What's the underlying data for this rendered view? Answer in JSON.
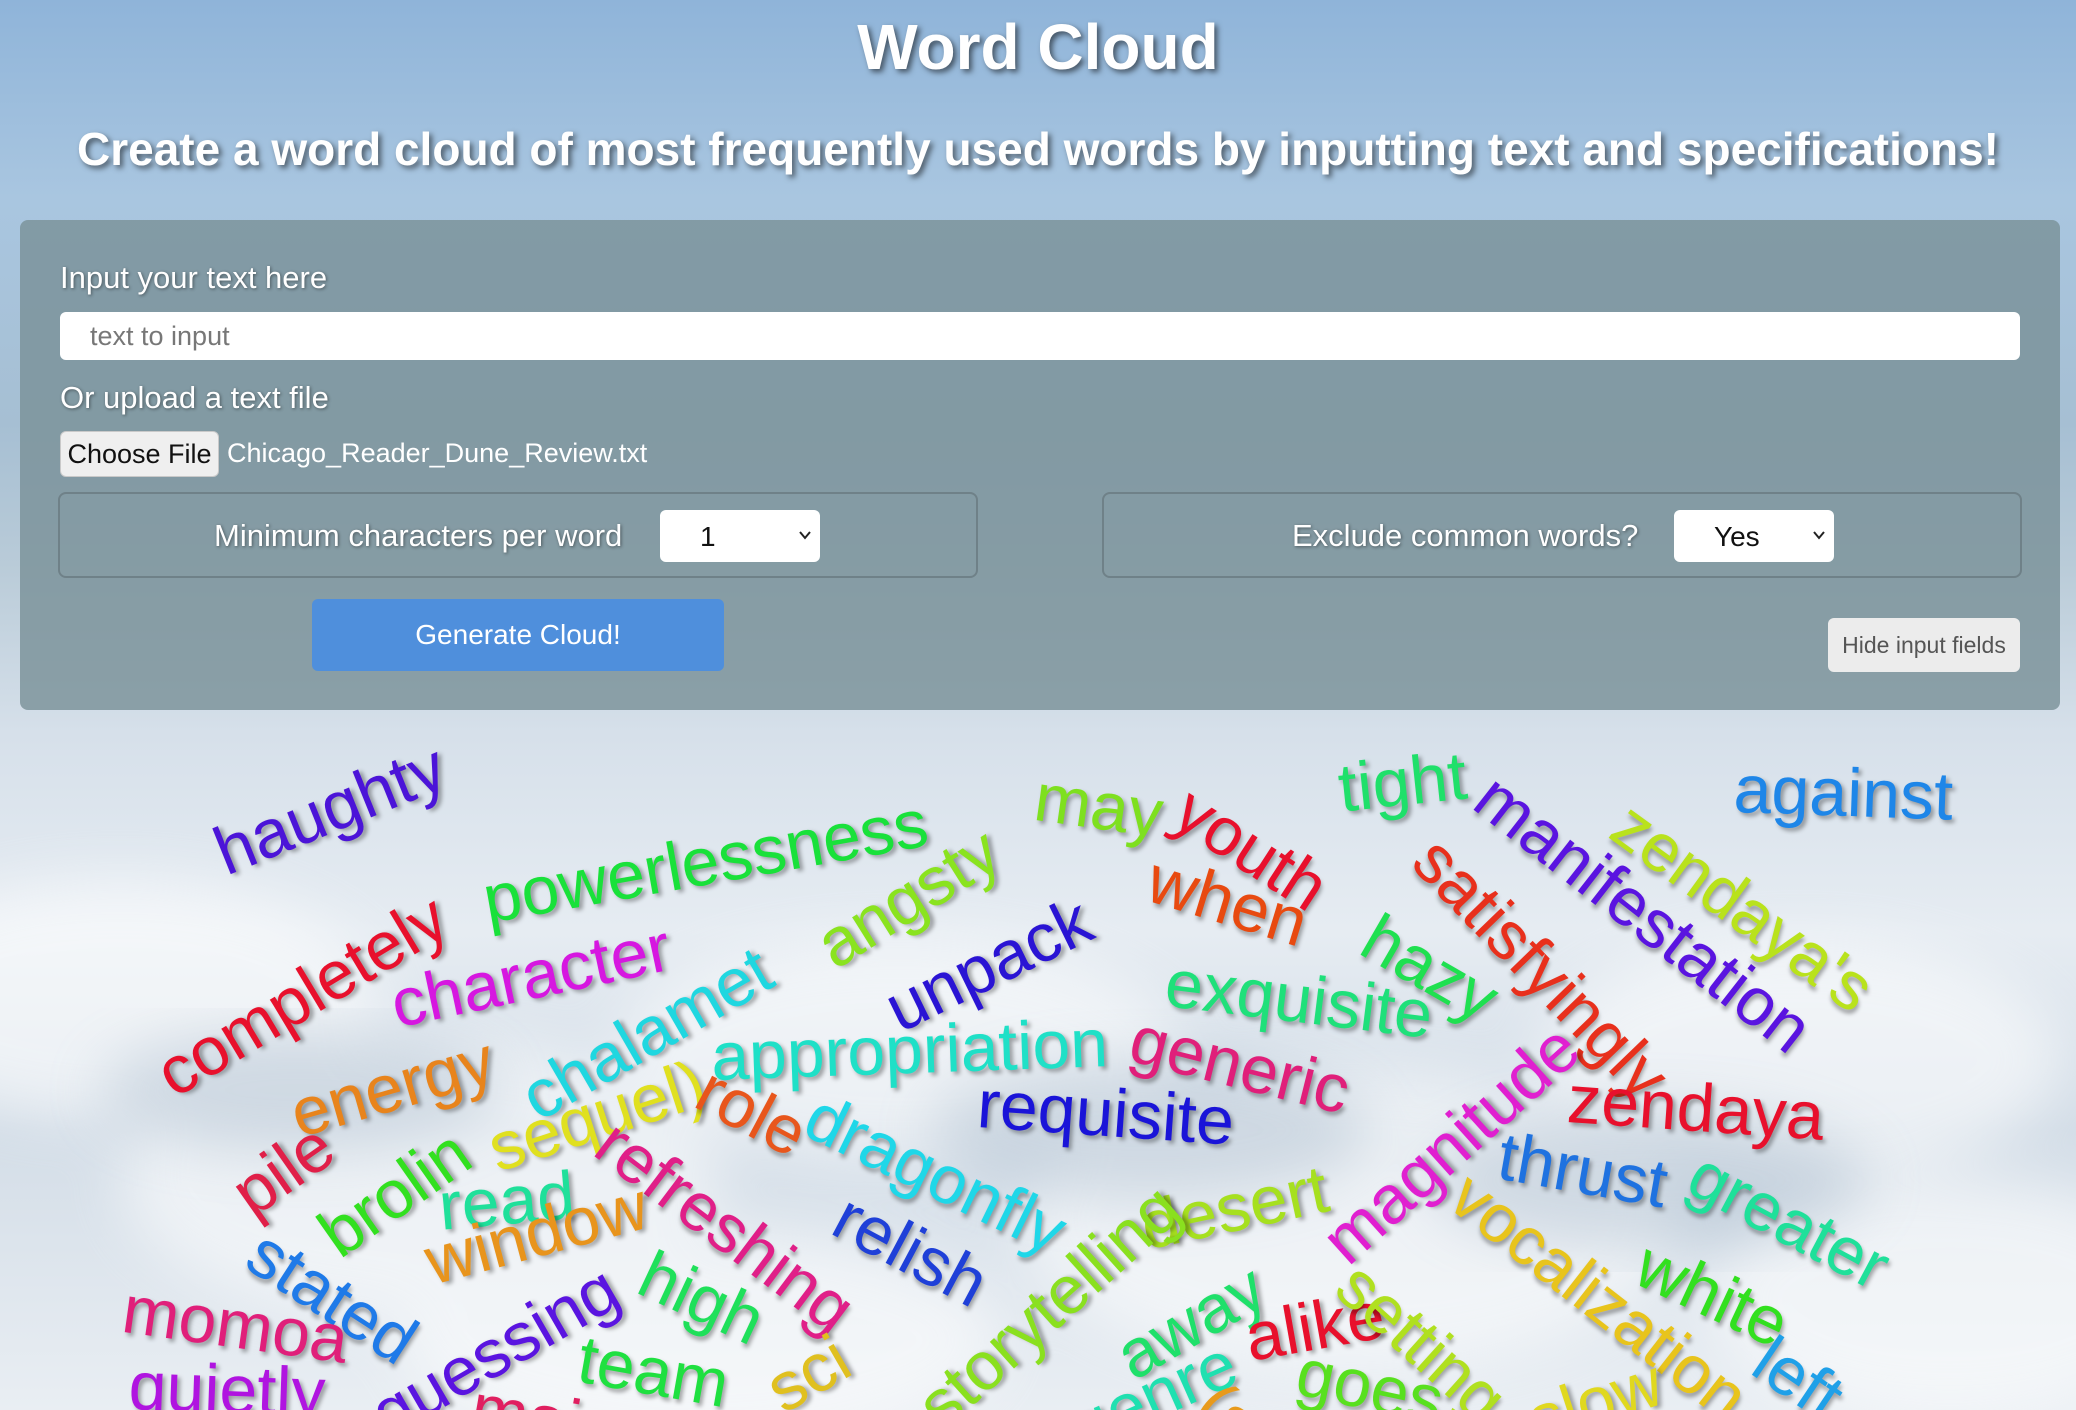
{
  "header": {
    "title": "Word Cloud",
    "subtitle": "Create a word cloud of most frequently used words by inputting text and specifications!"
  },
  "form": {
    "text_label": "Input your text here",
    "text_placeholder": "text to input",
    "text_value": "",
    "upload_label": "Or upload a text file",
    "file_button_label": "Choose File",
    "file_name": "Chicago_Reader_Dune_Review.txt",
    "min_chars_label": "Minimum characters per word",
    "min_chars_value": "1",
    "exclude_label": "Exclude common words?",
    "exclude_value": "Yes",
    "generate_label": "Generate Cloud!",
    "hide_label": "Hide input fields"
  },
  "words": [
    {
      "text": "haughty",
      "color": "#4b14d8"
    },
    {
      "text": "powerlessness",
      "color": "#19e13a"
    },
    {
      "text": "may",
      "color": "#7ee01f"
    },
    {
      "text": "youth",
      "color": "#e8102c"
    },
    {
      "text": "tight",
      "color": "#1fe06a"
    },
    {
      "text": "manifestation",
      "color": "#5a14e0"
    },
    {
      "text": "zendaya's",
      "color": "#b9e21c"
    },
    {
      "text": "against",
      "color": "#1e86e8"
    },
    {
      "text": "completely",
      "color": "#e8102c"
    },
    {
      "text": "character",
      "color": "#d617e0"
    },
    {
      "text": "angsty",
      "color": "#8ae31f"
    },
    {
      "text": "unpack",
      "color": "#2a14d4"
    },
    {
      "text": "when",
      "color": "#e84a10"
    },
    {
      "text": "satisfyingly",
      "color": "#e8301c"
    },
    {
      "text": "hazy",
      "color": "#1fe050"
    },
    {
      "text": "chalamet",
      "color": "#1fd7e0"
    },
    {
      "text": "energy",
      "color": "#e8841c"
    },
    {
      "text": "appropriation",
      "color": "#1fe0c7"
    },
    {
      "text": "exquisite",
      "color": "#1fe07a"
    },
    {
      "text": "generic",
      "color": "#e01f7a"
    },
    {
      "text": "pile",
      "color": "#e01f48"
    },
    {
      "text": "brolin",
      "color": "#32e01f"
    },
    {
      "text": "sequel)",
      "color": "#e0e01f"
    },
    {
      "text": "role",
      "color": "#e8561c"
    },
    {
      "text": "dragonfly",
      "color": "#1fd7e8"
    },
    {
      "text": "requisite",
      "color": "#1a14d8"
    },
    {
      "text": "magnitude",
      "color": "#e01fd0"
    },
    {
      "text": "zendaya",
      "color": "#e8102c"
    },
    {
      "text": "read",
      "color": "#1fe09a"
    },
    {
      "text": "refreshing",
      "color": "#e01f88"
    },
    {
      "text": "desert",
      "color": "#a6e01f"
    },
    {
      "text": "thrust",
      "color": "#1f72e0"
    },
    {
      "text": "greater",
      "color": "#1fe09a"
    },
    {
      "text": "stated",
      "color": "#1f7ae8"
    },
    {
      "text": "window",
      "color": "#e8941c"
    },
    {
      "text": "relish",
      "color": "#1f40d8"
    },
    {
      "text": "vocalization",
      "color": "#e8c41c"
    },
    {
      "text": "white",
      "color": "#32e01f"
    },
    {
      "text": "high",
      "color": "#1fe05a"
    },
    {
      "text": "storytelling",
      "color": "#8ae01f"
    },
    {
      "text": "away",
      "color": "#1fe06a"
    },
    {
      "text": "alike",
      "color": "#e8102c"
    },
    {
      "text": "setting",
      "color": "#b0e01f"
    },
    {
      "text": "momoa",
      "color": "#e01f7a"
    },
    {
      "text": "guessing",
      "color": "#5a14e0"
    },
    {
      "text": "team",
      "color": "#1fe040"
    },
    {
      "text": "sci",
      "color": "#e0c01f"
    },
    {
      "text": "genre",
      "color": "#1fe0b0"
    },
    {
      "text": "left",
      "color": "#1fa0e8"
    },
    {
      "text": "quietly",
      "color": "#b014e0"
    },
    {
      "text": "main",
      "color": "#e01f60"
    },
    {
      "text": "goes",
      "color": "#58e01f"
    },
    {
      "text": "slow",
      "color": "#e0d81f"
    },
    {
      "text": "(s",
      "color": "#e89a1c"
    }
  ]
}
